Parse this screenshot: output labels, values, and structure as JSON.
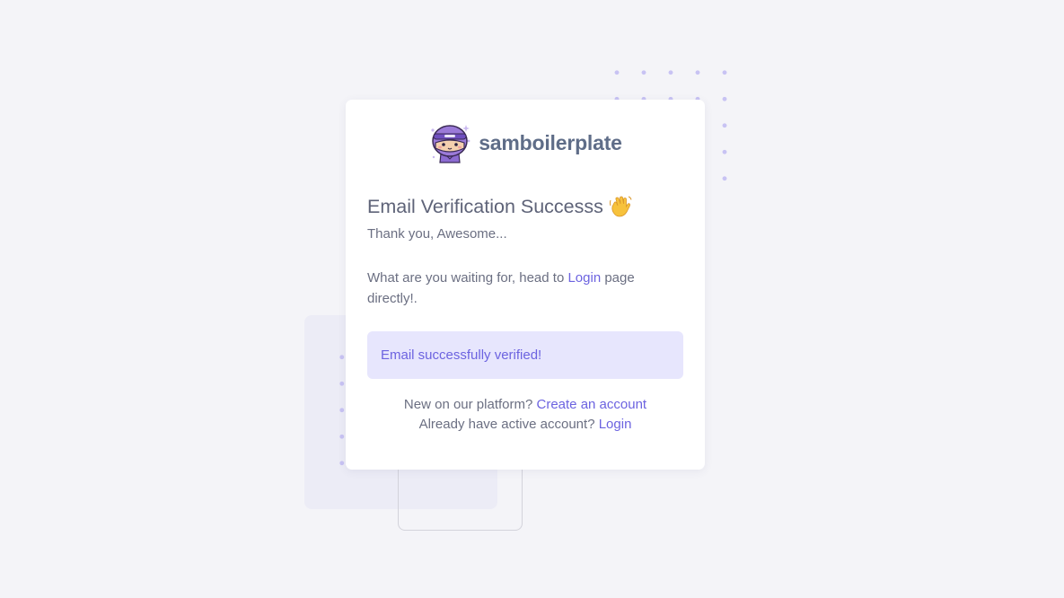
{
  "brand": {
    "name": "samboilerplate",
    "logo_icon": "ninja-mascot-icon"
  },
  "card": {
    "title": "Email Verification Successs",
    "title_icon": "waving-hand-icon",
    "subtitle": "Thank you, Awesome...",
    "body_prefix": "What are you waiting for, head to",
    "body_link": "Login",
    "body_suffix": "page directly!.",
    "alert_message": "Email successfully verified!"
  },
  "footer": {
    "register_prompt": "New on our platform?",
    "register_link": "Create an account",
    "login_prompt": "Already have active account?",
    "login_link": "Login"
  },
  "colors": {
    "accent": "#6c63e0",
    "alert_background": "#e7e6fd",
    "page_background": "#f4f4f8",
    "brand_text": "#5f6d88"
  }
}
